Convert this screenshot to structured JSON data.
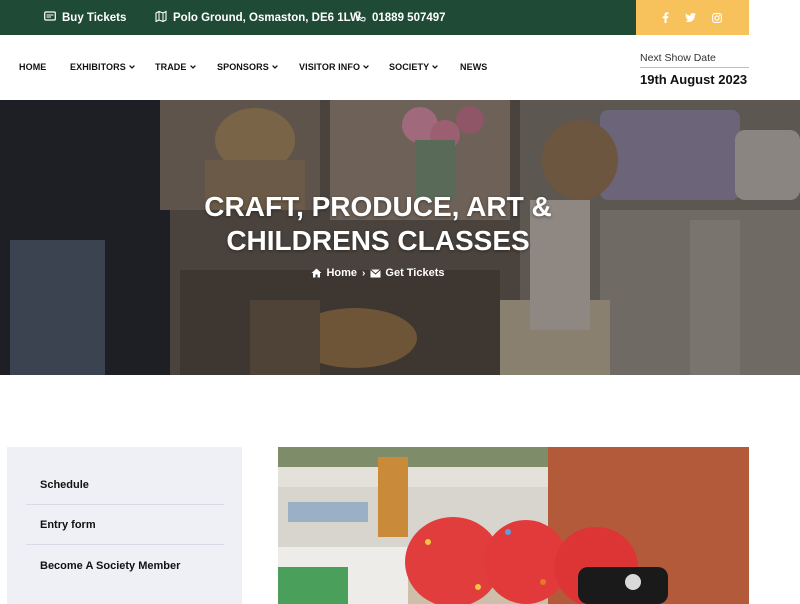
{
  "topbar": {
    "tickets_label": "Buy Tickets",
    "address": "Polo Ground, Osmaston, DE6 1LW",
    "phone": "01889 507497",
    "icons": [
      "ticket-icon",
      "map-icon",
      "phone-icon",
      "facebook-icon",
      "twitter-icon",
      "instagram-icon"
    ]
  },
  "nav": {
    "items": [
      {
        "label": "HOME",
        "dropdown": false
      },
      {
        "label": "EXHIBITORS",
        "dropdown": true
      },
      {
        "label": "TRADE",
        "dropdown": true
      },
      {
        "label": "SPONSORS",
        "dropdown": true
      },
      {
        "label": "VISITOR INFO",
        "dropdown": true
      },
      {
        "label": "SOCIETY",
        "dropdown": true
      },
      {
        "label": "NEWS",
        "dropdown": false
      }
    ],
    "next_show_label": "Next Show Date",
    "next_show_date": "19th August 2023"
  },
  "hero": {
    "title_line1": "CRAFT, PRODUCE, ART &",
    "title_line2": "CHILDRENS CLASSES",
    "breadcrumb": {
      "home": "Home",
      "current": "Get Tickets"
    }
  },
  "sidebar": {
    "items": [
      {
        "label": "Schedule"
      },
      {
        "label": "Entry form"
      },
      {
        "label": "Become A Society Member"
      }
    ]
  },
  "colors": {
    "topbar_green": "#1f4a36",
    "topbar_yellow": "#f7c25c",
    "sidebar_bg": "#eef0f5"
  }
}
